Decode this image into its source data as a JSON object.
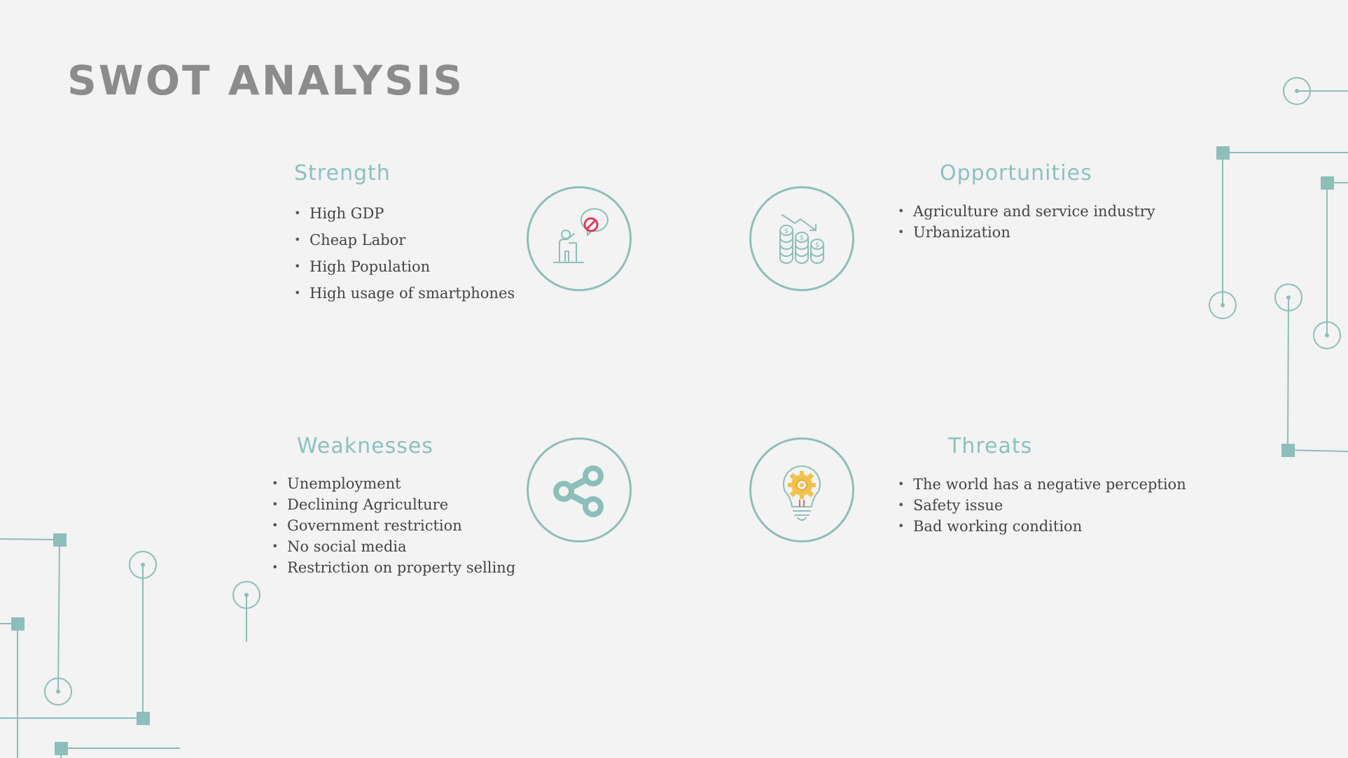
{
  "slide": {
    "title": "SWOT ANALYSIS",
    "accent_color": "#8cc1bd",
    "text_color": "#444444",
    "title_color": "#8c8c8c"
  },
  "strength": {
    "heading": "Strength",
    "items": [
      "High GDP",
      "Cheap Labor",
      "High Population",
      "High usage of smartphones"
    ],
    "icon": "protest-speaker-icon"
  },
  "opportunities": {
    "heading": "Opportunities",
    "items": [
      "Agriculture and service industry",
      "Urbanization"
    ],
    "icon": "coins-trend-icon"
  },
  "weaknesses": {
    "heading": "Weaknesses",
    "items": [
      "Unemployment",
      "Declining Agriculture",
      "Government restriction",
      "No social media",
      "Restriction on property selling"
    ],
    "icon": "share-icon"
  },
  "threats": {
    "heading": "Threats",
    "items": [
      "The world has a negative perception",
      "Safety issue",
      "Bad working condition"
    ],
    "icon": "lightbulb-gear-icon"
  }
}
